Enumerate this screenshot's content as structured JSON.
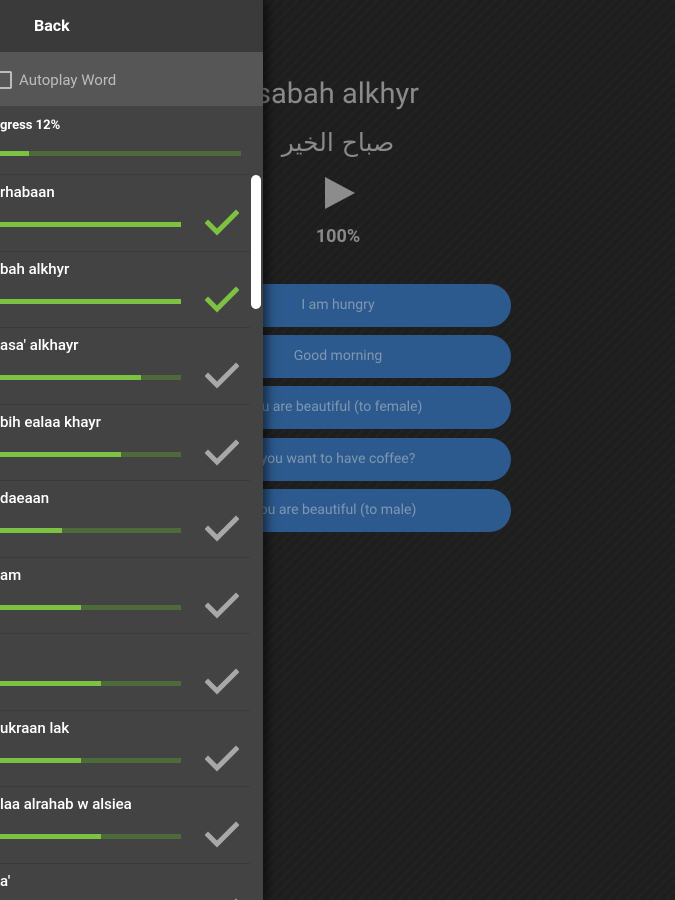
{
  "main": {
    "word_latin": "sabah alkhyr",
    "word_arabic": "صباح الخير",
    "play_icon": "play-icon",
    "percent": "100%",
    "answers": [
      "I am hungry",
      "Good morning",
      "ou are beautiful (to female)",
      "you want to have coffee?",
      "ou are beautiful (to male)"
    ]
  },
  "drawer": {
    "back_label": "Back",
    "autoplay_label": "Autoplay Word",
    "progress_label": "gress 12%",
    "progress_value": 0.12,
    "items": [
      {
        "label": "rhabaan",
        "progress": 1.0,
        "done": true
      },
      {
        "label": "bah alkhyr",
        "progress": 1.0,
        "done": true
      },
      {
        "label": "asa' alkhayr",
        "progress": 0.78,
        "done": false
      },
      {
        "label": "bih ealaa khayr",
        "progress": 0.67,
        "done": false
      },
      {
        "label": "daeaan",
        "progress": 0.34,
        "done": false
      },
      {
        "label": "am",
        "progress": 0.45,
        "done": false
      },
      {
        "label": "",
        "progress": 0.56,
        "done": false
      },
      {
        "label": "ukraan lak",
        "progress": 0.45,
        "done": false
      },
      {
        "label": "laa alrahab w alsiea",
        "progress": 0.56,
        "done": false
      },
      {
        "label": "a'",
        "progress": 0.0,
        "done": false
      }
    ]
  },
  "colors": {
    "accent_green": "#7dc242",
    "check_done": "#7dc242",
    "check_pending": "#a8a8a8",
    "answer_blue": "#2c5a8e"
  }
}
